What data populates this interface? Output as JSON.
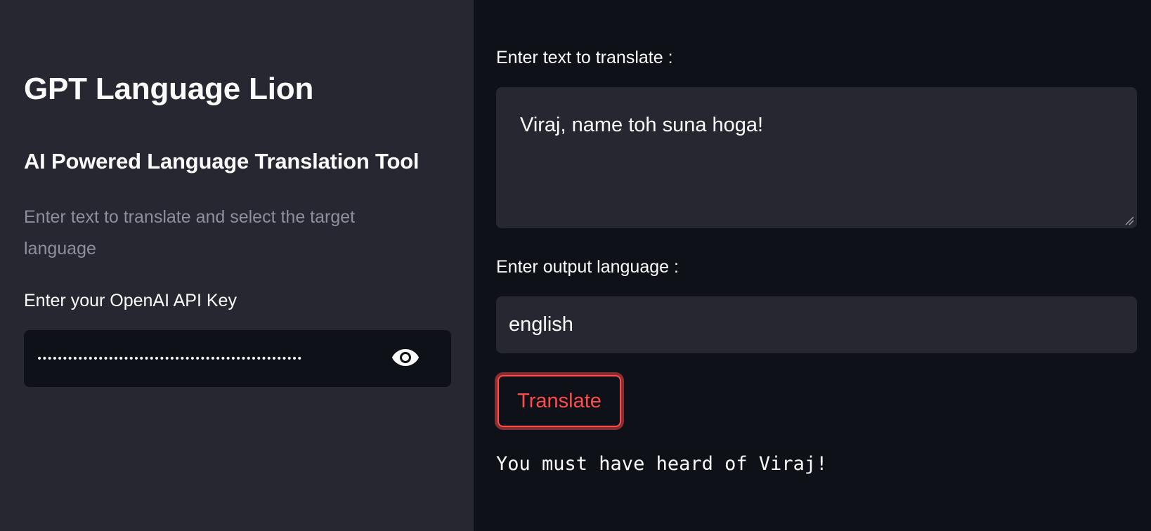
{
  "sidebar": {
    "title": "GPT Language Lion",
    "subtitle": "AI Powered Language Translation Tool",
    "description": "Enter text to translate and select the target language",
    "api_key": {
      "label": "Enter your OpenAI API Key",
      "masked_value": "••••••••••••••••••••••••••••••••••••••••••••••••••••",
      "toggle_icon": "eye-icon"
    }
  },
  "main": {
    "input_text": {
      "label": "Enter text to translate :",
      "value": "Viraj, name toh suna hoga!"
    },
    "output_language": {
      "label": "Enter output language :",
      "value": "english"
    },
    "translate_button": {
      "label": "Translate"
    },
    "result": "You must have heard of Viraj!"
  },
  "colors": {
    "sidebar_bg": "#262730",
    "main_bg": "#0e1117",
    "accent": "#ff4b4b",
    "text": "#fafafa",
    "muted_text": "#8d8f9c"
  }
}
